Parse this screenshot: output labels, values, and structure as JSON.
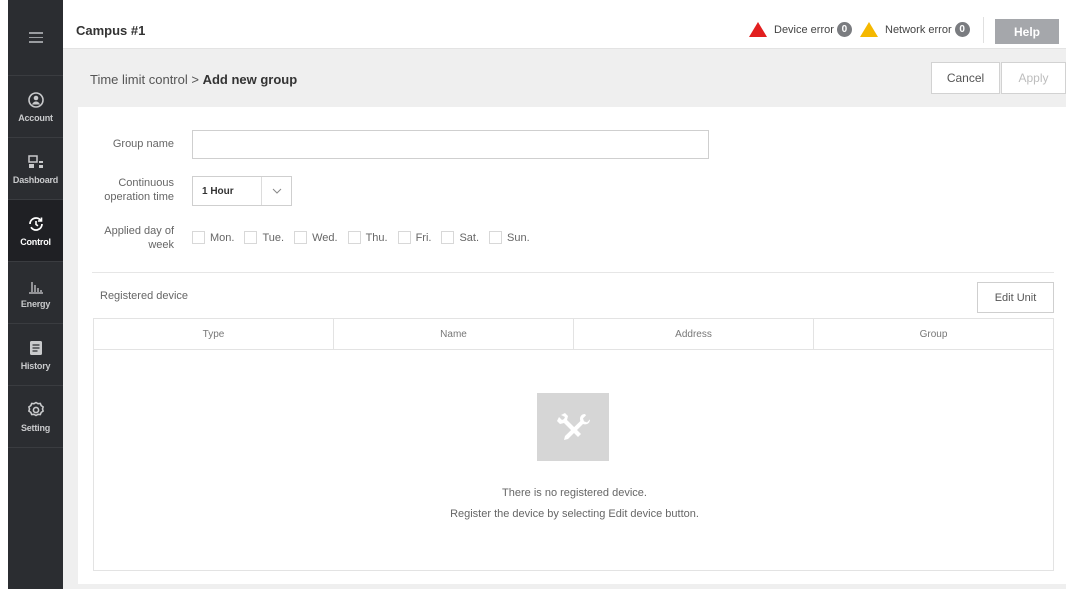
{
  "header": {
    "site_title": "Campus #1",
    "device_error_label": "Device error",
    "device_error_count": "0",
    "network_error_label": "Network error",
    "network_error_count": "0",
    "help_label": "Help",
    "device_error_color": "#e21f1f",
    "network_error_color": "#f5b800"
  },
  "sidebar": {
    "menu_icon": "hamburger-icon",
    "items": [
      {
        "label": "Account",
        "icon": "account-icon"
      },
      {
        "label": "Dashboard",
        "icon": "dashboard-icon"
      },
      {
        "label": "Control",
        "icon": "control-icon",
        "active": true
      },
      {
        "label": "Energy",
        "icon": "energy-chart-icon"
      },
      {
        "label": "History",
        "icon": "history-icon"
      },
      {
        "label": "Setting",
        "icon": "gear-icon"
      }
    ]
  },
  "breadcrumb": {
    "parent": "Time limit control",
    "separator": " > ",
    "current": "Add new group"
  },
  "actions": {
    "cancel": "Cancel",
    "apply": "Apply"
  },
  "form": {
    "group_name_label": "Group name",
    "group_name_value": "",
    "op_time_label_1": "Continuous",
    "op_time_label_2": "operation time",
    "op_time_value": "1 Hour",
    "days_label_1": "Applied day of",
    "days_label_2": "week",
    "days": [
      "Mon.",
      "Tue.",
      "Wed.",
      "Thu.",
      "Fri.",
      "Sat.",
      "Sun."
    ]
  },
  "registered": {
    "label": "Registered device",
    "edit_button": "Edit Unit",
    "columns": [
      "Type",
      "Name",
      "Address",
      "Group"
    ],
    "empty_icon": "tools-icon",
    "empty_line1": "There is no registered device.",
    "empty_line2": "Register the device by selecting Edit device button."
  }
}
